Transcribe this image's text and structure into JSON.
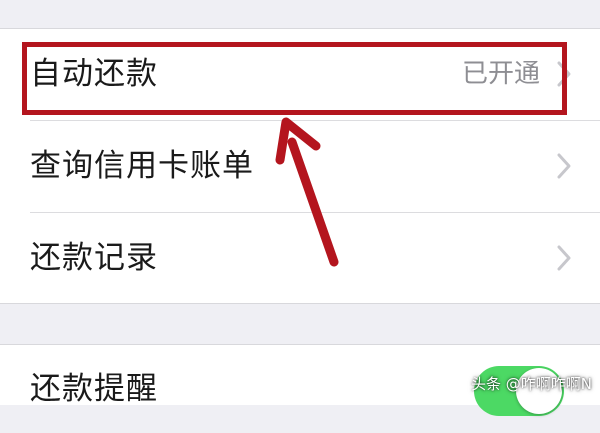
{
  "settings": {
    "group1": [
      {
        "label": "自动还款",
        "value": "已开通",
        "chevron": "chevron-right-icon"
      },
      {
        "label": "查询信用卡账单",
        "value": "",
        "chevron": "chevron-right-icon"
      },
      {
        "label": "还款记录",
        "value": "",
        "chevron": "chevron-right-icon"
      }
    ],
    "group2": [
      {
        "label": "还款提醒",
        "toggle_on": true
      }
    ]
  },
  "annotation": {
    "highlight_color": "#b4151e",
    "arrow_icon": "arrow-up-left-icon"
  },
  "colors": {
    "background": "#efeff4",
    "toggle_on": "#4cd964"
  },
  "watermark": "头条 @咋啊咋啊N"
}
